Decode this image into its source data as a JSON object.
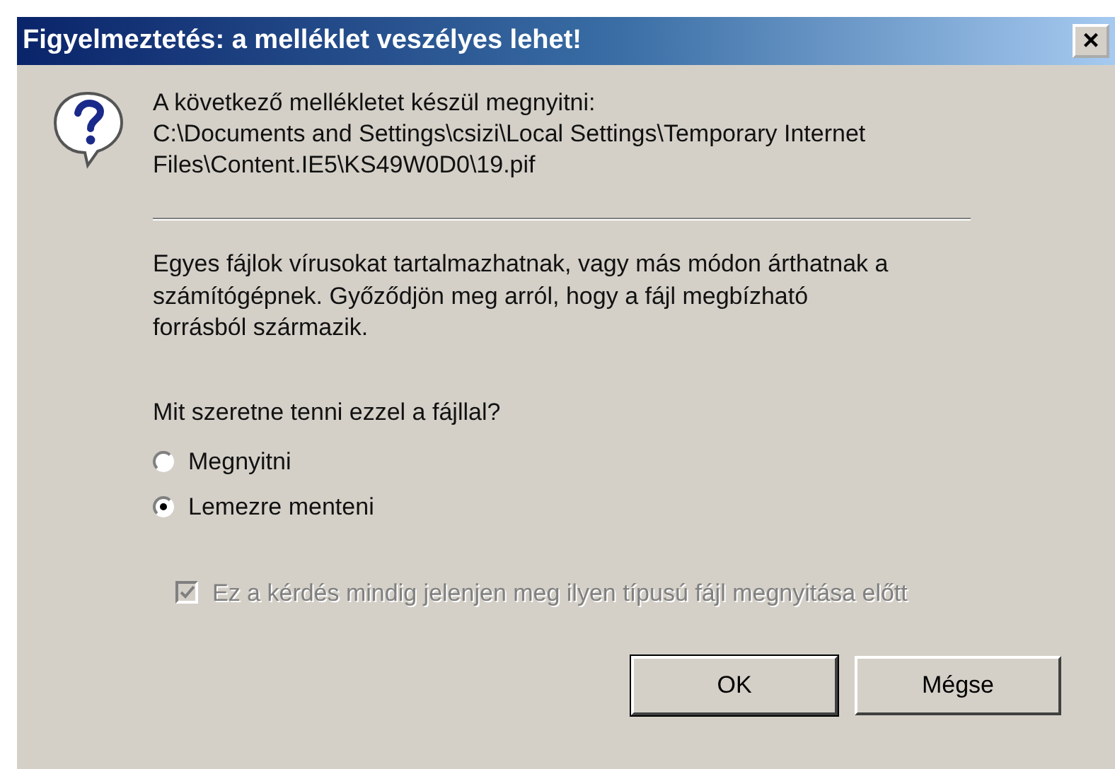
{
  "window": {
    "title": "Figyelmeztetés: a melléklet veszélyes lehet!",
    "close": "×"
  },
  "intro": [
    "A következő mellékletet készül megnyitni:",
    "C:\\Documents and Settings\\csizi\\Local Settings\\Temporary Internet Files\\Content.IE5\\KS49W0D0\\19.pif"
  ],
  "warning": "Egyes fájlok vírusokat tartalmazhatnak, vagy más módon árthatnak a számítógépnek. Győződjön meg arról, hogy a fájl megbízható forrásból származik.",
  "question": "Mit szeretne tenni ezzel a fájllal?",
  "options": [
    {
      "label": "Megnyitni",
      "selected": false
    },
    {
      "label": "Lemezre menteni",
      "selected": true
    }
  ],
  "always_ask": {
    "label": "Ez a kérdés mindig jelenjen meg ilyen típusú fájl megnyitása előtt",
    "checked": true,
    "disabled": true
  },
  "buttons": [
    {
      "label": "OK",
      "default": true
    },
    {
      "label": "Mégse",
      "default": false
    }
  ]
}
